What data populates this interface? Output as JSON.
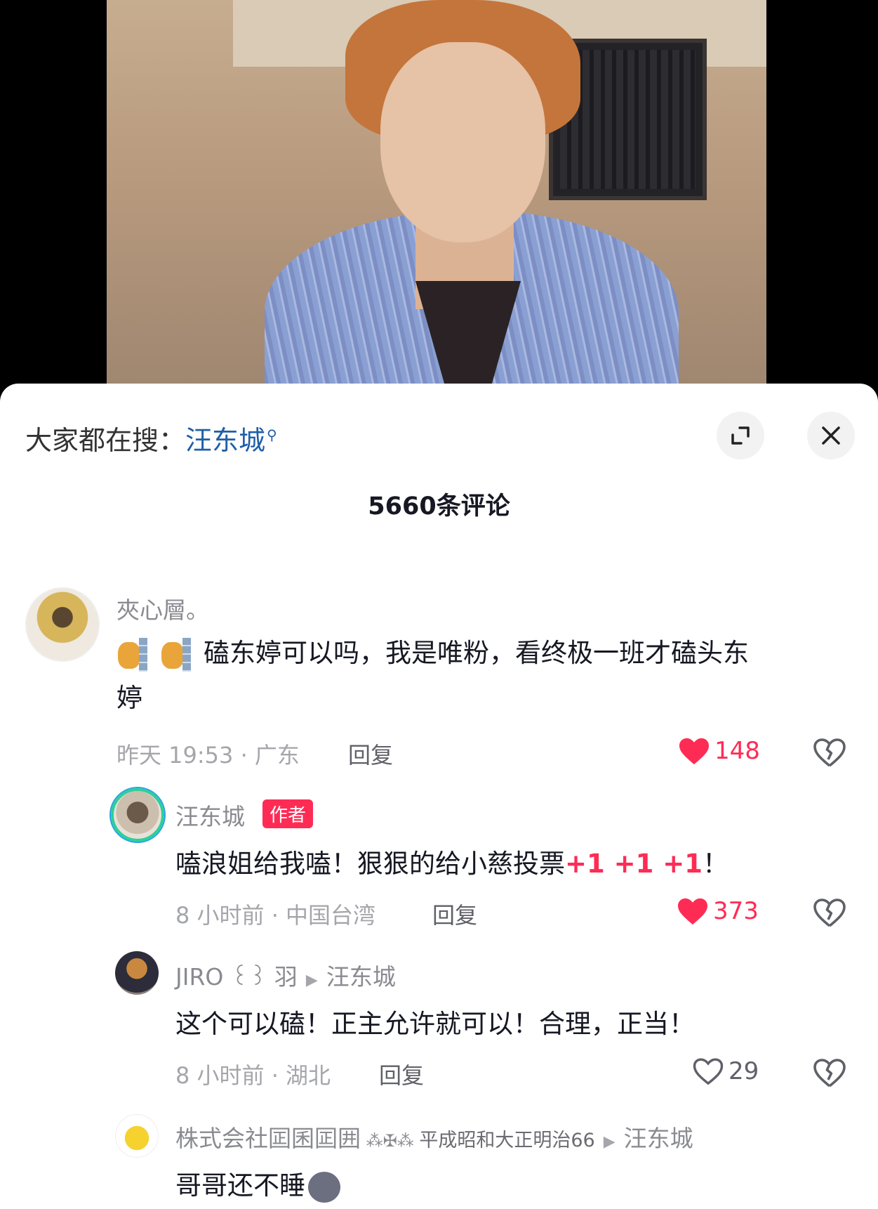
{
  "search": {
    "prefix": "大家都在搜：",
    "term": "汪东城"
  },
  "comments_count_title": "5660条评论",
  "comments": [
    {
      "username": "夾心層。",
      "text_line1": "磕东婷可以吗，我是唯粉，看终极一班才磕头东",
      "text_line2": "婷",
      "time_location": "昨天 19:53 · 广东",
      "reply_label": "回复",
      "likes": "148",
      "liked": true
    },
    {
      "username": "汪东城",
      "badge": "作者",
      "text": "嗑浪姐给我嗑！狠狠的给小慈投票",
      "text_suffix_red": "+1 +1 +1",
      "text_end": "！",
      "time_location": "8 小时前 · 中国台湾",
      "reply_label": "回复",
      "likes": "373",
      "liked": true
    },
    {
      "username": "JIRO ꒰꒱ 羽",
      "reply_to": "汪东城",
      "text": "这个可以磕！正主允许就可以！合理，正当！",
      "time_location": "8 小时前 · 湖北",
      "reply_label": "回复",
      "likes": "29",
      "liked": false
    },
    {
      "username": "株式会社囸囷囸囲",
      "username_extra": "平成昭和大正明治66",
      "reply_to": "汪东城",
      "text": "哥哥还不睡"
    }
  ],
  "icons": {
    "expand": "expand-icon",
    "close": "close-icon",
    "search": "search-icon",
    "like": "heart-icon",
    "dislike": "broken-heart-icon",
    "reply_arrow": "triangle-right-icon"
  },
  "colors": {
    "accent_red": "#fe2c55",
    "link_blue": "#1f5fa8"
  }
}
